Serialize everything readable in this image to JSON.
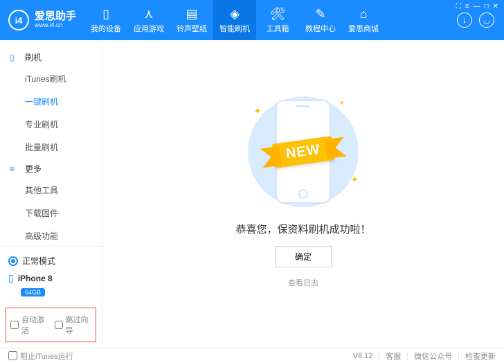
{
  "header": {
    "brand": "爱思助手",
    "url": "www.i4.cn",
    "tabs": [
      {
        "label": "我的设备",
        "icon": "▯"
      },
      {
        "label": "应用游戏",
        "icon": "⋏"
      },
      {
        "label": "铃声壁纸",
        "icon": "▤"
      },
      {
        "label": "智能刷机",
        "icon": "◈"
      },
      {
        "label": "工具箱",
        "icon": "🛠"
      },
      {
        "label": "教程中心",
        "icon": "✎"
      },
      {
        "label": "爱思商城",
        "icon": "⌂"
      }
    ],
    "active_tab": 3,
    "winctrls": [
      "⛶",
      "≡",
      "—",
      "□",
      "✕"
    ]
  },
  "sidebar": {
    "groups": [
      {
        "icon": "▯",
        "label": "刷机",
        "items": [
          "iTunes刷机",
          "一键刷机",
          "专业刷机",
          "批量刷机"
        ],
        "active": 1
      },
      {
        "icon": "≡",
        "label": "更多",
        "items": [
          "其他工具",
          "下载固件",
          "高级功能"
        ],
        "active": -1
      }
    ],
    "mode_label": "正常模式",
    "device_name": "iPhone 8",
    "device_capacity": "64GB",
    "check_auto": "自动激活",
    "check_skip": "跳过向导"
  },
  "main": {
    "ribbon": "NEW",
    "message": "恭喜您，保资料刷机成功啦！",
    "ok": "确定",
    "log": "查看日志"
  },
  "footer": {
    "block_itunes": "阻止iTunes运行",
    "version": "V8.12",
    "links": [
      "客服",
      "微信公众号",
      "检查更新"
    ]
  }
}
